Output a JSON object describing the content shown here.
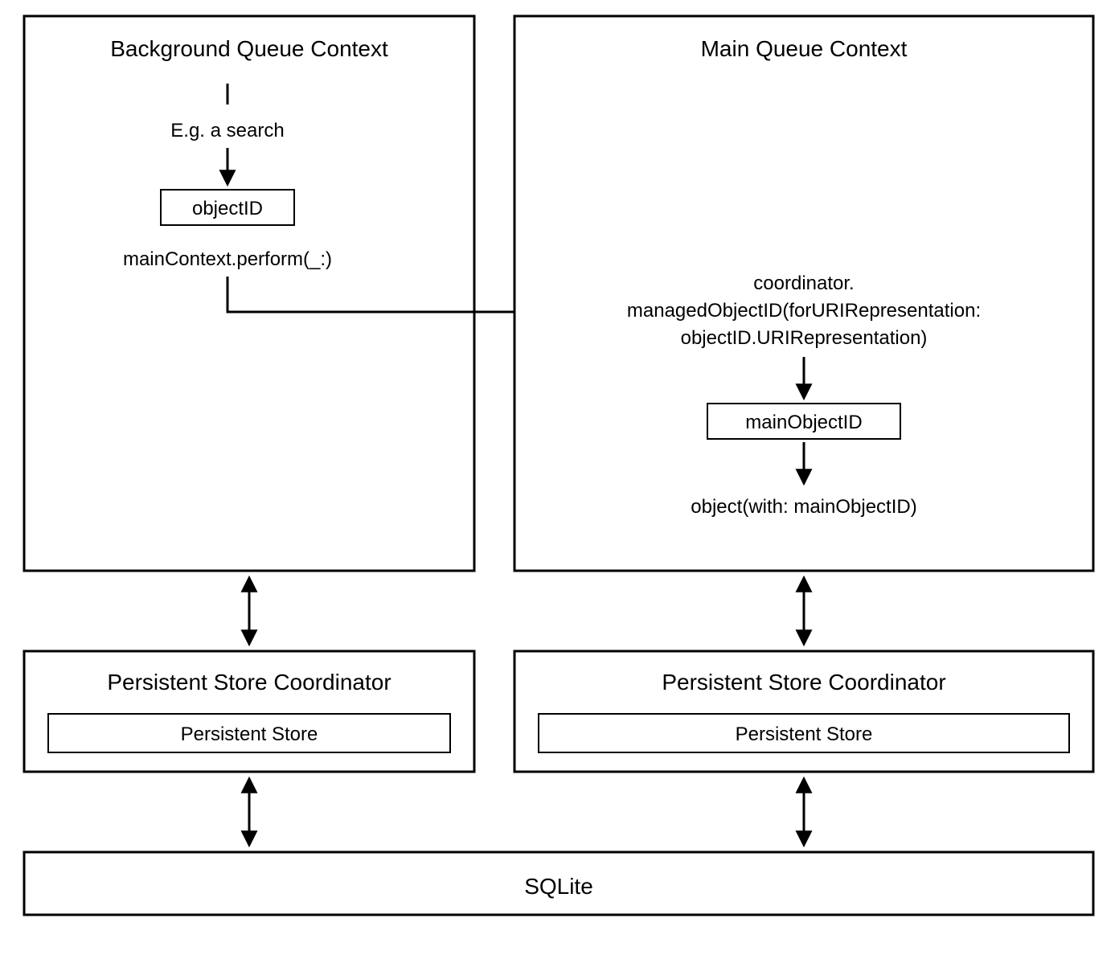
{
  "bg_context": {
    "title": "Background Queue Context",
    "search_label": "E.g. a search",
    "object_id_label": "objectID",
    "perform_label": "mainContext.perform(_:)"
  },
  "main_context": {
    "title": "Main Queue Context",
    "coord_line1": "coordinator.",
    "coord_line2": "managedObjectID(forURIRepresentation:",
    "coord_line3": "objectID.URIRepresentation)",
    "main_object_id_label": "mainObjectID",
    "object_with_label": "object(with: mainObjectID)"
  },
  "psc_left": {
    "title": "Persistent Store Coordinator",
    "store_label": "Persistent Store"
  },
  "psc_right": {
    "title": "Persistent Store Coordinator",
    "store_label": "Persistent Store"
  },
  "sqlite": {
    "title": "SQLite"
  }
}
